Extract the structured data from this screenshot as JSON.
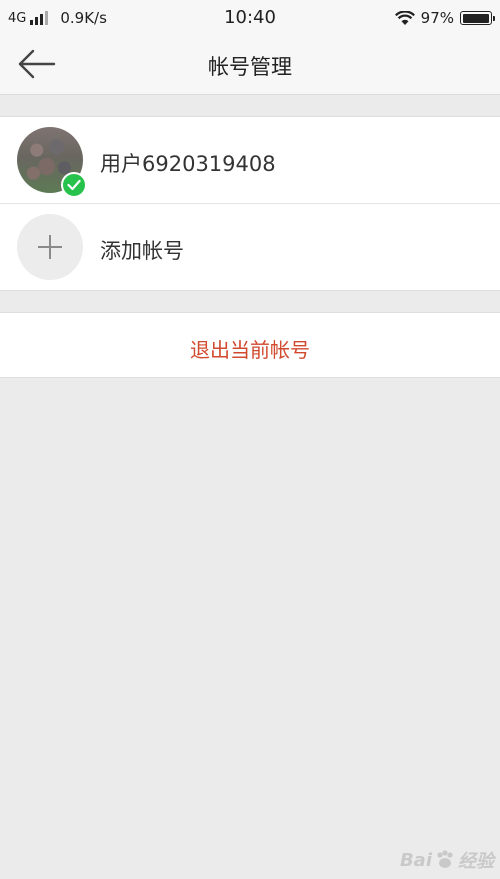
{
  "status_bar": {
    "network_type": "4G",
    "speed": "0.9K/s",
    "time": "10:40",
    "battery_percent": "97%",
    "battery_level": 0.97,
    "icons": [
      "signal-icon",
      "wifi-icon",
      "battery-icon"
    ]
  },
  "nav": {
    "title": "帐号管理",
    "back_icon": "arrow-left-icon"
  },
  "accounts": [
    {
      "name": "用户6920319408",
      "selected": true,
      "status_icon": "check-icon"
    }
  ],
  "add_account": {
    "label": "添加帐号",
    "icon": "plus-icon"
  },
  "logout": {
    "label": "退出当前帐号",
    "color": "#d14a2e"
  },
  "watermark": {
    "text_left": "Bai",
    "text_right": "经验"
  },
  "colors": {
    "check_green": "#27c24c",
    "background": "#ebebeb"
  }
}
